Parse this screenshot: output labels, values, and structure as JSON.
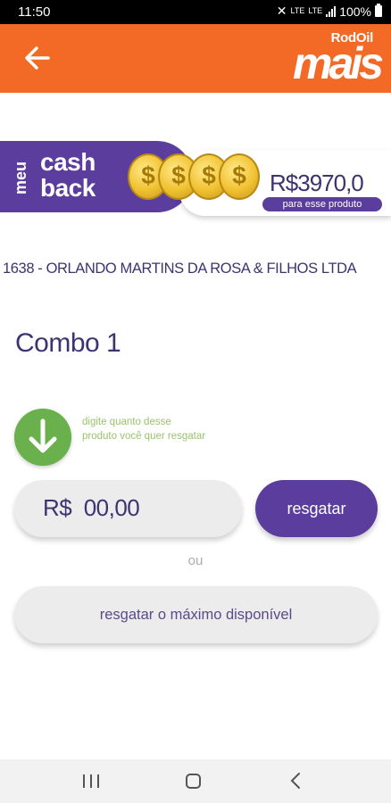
{
  "status_bar": {
    "time": "11:50",
    "indicator_a": "LTE",
    "indicator_b": "LTE",
    "battery_percent": "100%"
  },
  "header": {
    "logo_top": "RodOil",
    "logo_main": "mais",
    "accent_color": "#f26a25"
  },
  "cashback": {
    "label_meu": "meu",
    "label_cash": "cash",
    "label_back": "back",
    "coin_symbol": "$",
    "amount": "R$3970,0",
    "caption": "para esse produto",
    "brand_color": "#5b3d9e"
  },
  "company": "1638 - ORLANDO MARTINS DA ROSA & FILHOS LTDA",
  "product": "Combo 1",
  "instruction": "digite quanto desse produto você quer resgatar",
  "amount_field": {
    "currency": "R$",
    "value": "00,00"
  },
  "redeem_label": "resgatar",
  "or_label": "ou",
  "redeem_max_label": "resgatar o máximo disponível"
}
